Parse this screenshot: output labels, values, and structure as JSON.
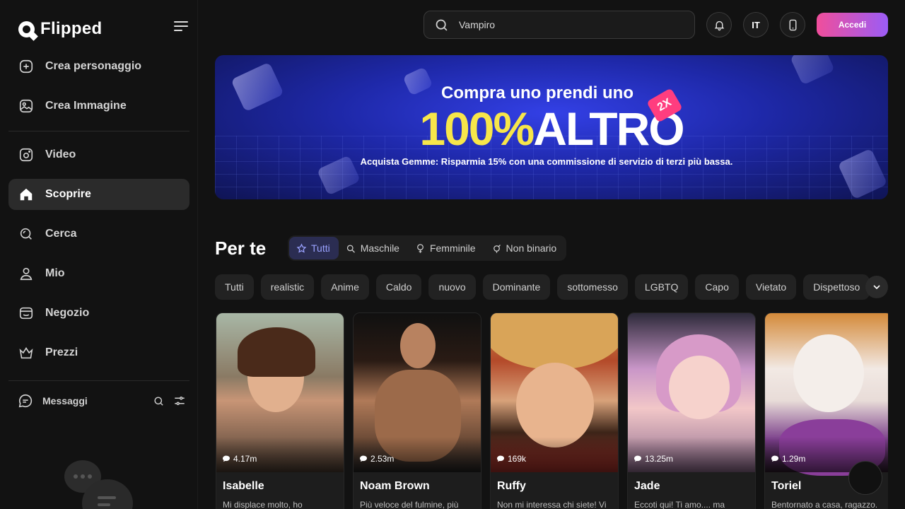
{
  "app": {
    "logo_text": "Flipped"
  },
  "sidebar": {
    "items": [
      {
        "label": "Crea personaggio",
        "icon": "plus-square-icon"
      },
      {
        "label": "Crea Immagine",
        "icon": "image-icon"
      },
      {
        "label": "Video",
        "icon": "video-icon"
      },
      {
        "label": "Scoprire",
        "icon": "home-icon",
        "active": true
      },
      {
        "label": "Cerca",
        "icon": "search-icon"
      },
      {
        "label": "Mio",
        "icon": "user-icon"
      },
      {
        "label": "Negozio",
        "icon": "store-icon"
      },
      {
        "label": "Prezzi",
        "icon": "crown-icon"
      }
    ],
    "messages_label": "Messaggi"
  },
  "header": {
    "search_value": "Vampiro",
    "language": "IT",
    "login_label": "Accedi"
  },
  "banner": {
    "line1": "Compra uno prendi uno",
    "line2_highlight": "100%",
    "line2_rest": "ALTRO",
    "tag": "2X",
    "line3": "Acquista Gemme: Risparmia 15% con una commissione di servizio di terzi più bassa."
  },
  "section": {
    "title": "Per te",
    "gender_tabs": [
      "Tutti",
      "Maschile",
      "Femminile",
      "Non binario"
    ],
    "active_gender_tab": "Tutti",
    "chips": [
      "Tutti",
      "realistic",
      "Anime",
      "Caldo",
      "nuovo",
      "Dominante",
      "sottomesso",
      "LGBTQ",
      "Capo",
      "Vietato",
      "Dispettoso"
    ]
  },
  "cards": [
    {
      "name": "Isabelle",
      "count": "4.17m",
      "desc": "Mi displace molto, ho"
    },
    {
      "name": "Noam Brown",
      "count": "2.53m",
      "desc": "Più veloce del fulmine, più"
    },
    {
      "name": "Ruffy",
      "count": "169k",
      "desc": "Non mi interessa chi siete! Vi"
    },
    {
      "name": "Jade",
      "count": "13.25m",
      "desc": "Eccoti qui! Ti amo.... ma"
    },
    {
      "name": "Toriel",
      "count": "1.29m",
      "desc": "Bentornato a casa, ragazzo."
    }
  ],
  "colors": {
    "accent_start": "#f04e9b",
    "accent_end": "#9b5cf6",
    "active_tab": "#9aa2ff",
    "banner_highlight": "#f7e64a"
  }
}
